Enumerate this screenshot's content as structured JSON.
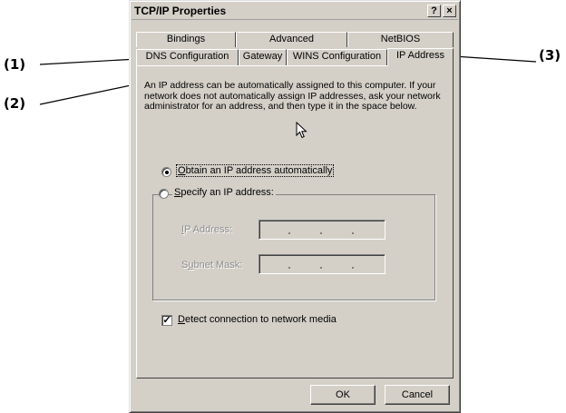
{
  "window": {
    "title": "TCP/IP Properties",
    "help_button": "?",
    "close_button": "×"
  },
  "tabs": {
    "row1": [
      "Bindings",
      "Advanced",
      "NetBIOS"
    ],
    "row2": [
      "DNS Configuration",
      "Gateway",
      "WINS Configuration",
      "IP Address"
    ],
    "active": "IP Address"
  },
  "description": "An IP address can be automatically assigned to this computer. If your network does not automatically assign IP addresses, ask your network administrator for an address, and then type it in the space below.",
  "options": {
    "obtain_auto": {
      "mnemonic": "O",
      "rest": "btain an IP address automatically",
      "selected": true
    },
    "specify": {
      "mnemonic": "S",
      "rest": "pecify an IP address:",
      "selected": false
    }
  },
  "fields": {
    "ip_address": {
      "mnemonic": "I",
      "rest": "P Address:",
      "value": ""
    },
    "subnet_mask": {
      "pre": "S",
      "mnemonic": "u",
      "rest": "bnet Mask:",
      "value": ""
    }
  },
  "detect": {
    "mnemonic": "D",
    "rest": "etect connection to network media",
    "checked": true,
    "check_glyph": "✓"
  },
  "buttons": {
    "ok": "OK",
    "cancel": "Cancel"
  },
  "callouts": {
    "one": "(1)",
    "two": "(2)",
    "three": "(3)"
  },
  "colors": {
    "face": "#d4d0c8",
    "shadow": "#808080",
    "highlight": "#ffffff",
    "disabled_text": "#8c8c8c"
  }
}
